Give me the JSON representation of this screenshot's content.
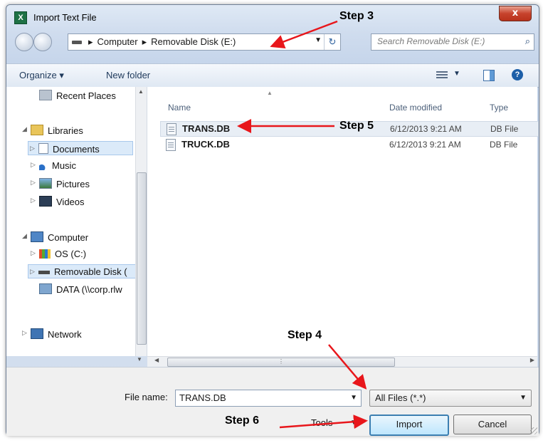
{
  "window": {
    "title": "Import Text File",
    "app_icon_letter": "X",
    "close_glyph": "x"
  },
  "address_bar": {
    "crumbs": [
      "Computer",
      "Removable Disk (E:)"
    ],
    "separator": "▸",
    "dropdown": "▼",
    "refresh": "↻"
  },
  "search": {
    "placeholder": "Search Removable Disk (E:)",
    "icon": "search-icon"
  },
  "toolbar": {
    "organize": "Organize ▾",
    "new_folder": "New folder",
    "view_dropdown": "▼",
    "help": "?"
  },
  "nav": {
    "recent_places": "Recent Places",
    "libraries": "Libraries",
    "documents": "Documents",
    "music": "Music",
    "pictures": "Pictures",
    "videos": "Videos",
    "computer": "Computer",
    "os": "OS (C:)",
    "removable": "Removable Disk (",
    "data": "DATA (\\\\corp.rlw",
    "network": "Network"
  },
  "columns": {
    "name": "Name",
    "date": "Date modified",
    "type": "Type"
  },
  "files": [
    {
      "name": "TRANS.DB",
      "date": "6/12/2013 9:21 AM",
      "type": "DB File"
    },
    {
      "name": "TRUCK.DB",
      "date": "6/12/2013 9:21 AM",
      "type": "DB File"
    }
  ],
  "bottom": {
    "file_name_label": "File name:",
    "file_name_value": "TRANS.DB",
    "filter": "All Files (*.*)",
    "tools": "Tools",
    "import": "Import",
    "cancel": "Cancel"
  },
  "annotations": {
    "step3": "Step 3",
    "step4": "Step 4",
    "step5": "Step 5",
    "step6": "Step 6"
  },
  "colors": {
    "arrow": "#e8161b",
    "selection": "#dbeaf9",
    "primary_border": "#3c7fb1"
  }
}
